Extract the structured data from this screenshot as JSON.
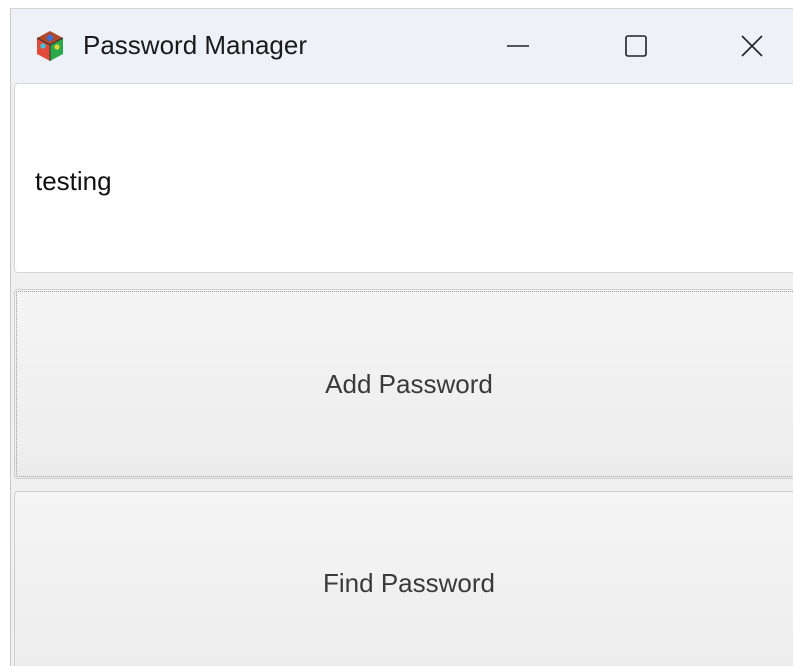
{
  "window": {
    "title": "Password Manager",
    "icon": "tk-cube-icon",
    "controls": {
      "minimize": "minimize-icon",
      "maximize": "maximize-icon",
      "close": "close-icon"
    }
  },
  "entry": {
    "value": "testing"
  },
  "buttons": {
    "add_label": "Add Password",
    "find_label": "Find Password"
  }
}
